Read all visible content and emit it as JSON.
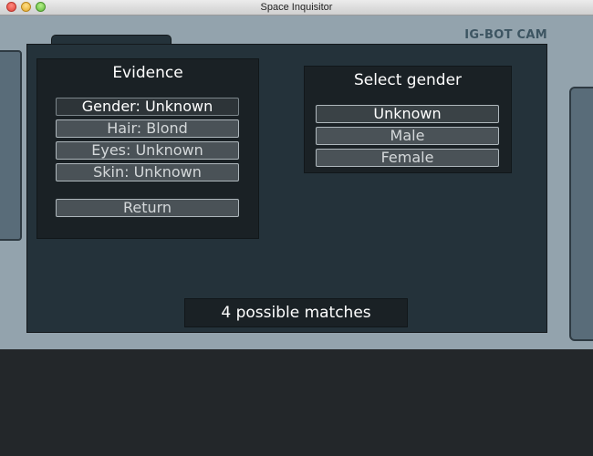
{
  "window": {
    "title": "Space Inquisitor"
  },
  "camera": {
    "label": "IG-BOT CAM"
  },
  "evidence": {
    "title": "Evidence",
    "items": [
      {
        "label": "Gender: Unknown",
        "active": true
      },
      {
        "label": "Hair: Blond",
        "active": false
      },
      {
        "label": "Eyes: Unknown",
        "active": false
      },
      {
        "label": "Skin: Unknown",
        "active": false
      }
    ],
    "return_label": "Return"
  },
  "gender_select": {
    "title": "Select gender",
    "options": [
      {
        "label": "Unknown",
        "selected": true
      },
      {
        "label": "Male",
        "selected": false
      },
      {
        "label": "Female",
        "selected": false
      }
    ]
  },
  "status": {
    "matches_text": "4 possible matches"
  },
  "colors": {
    "game_background": "#93a3ad",
    "panel": "#24323a",
    "box": "#1a2125",
    "camera_label": "#3d5562"
  }
}
